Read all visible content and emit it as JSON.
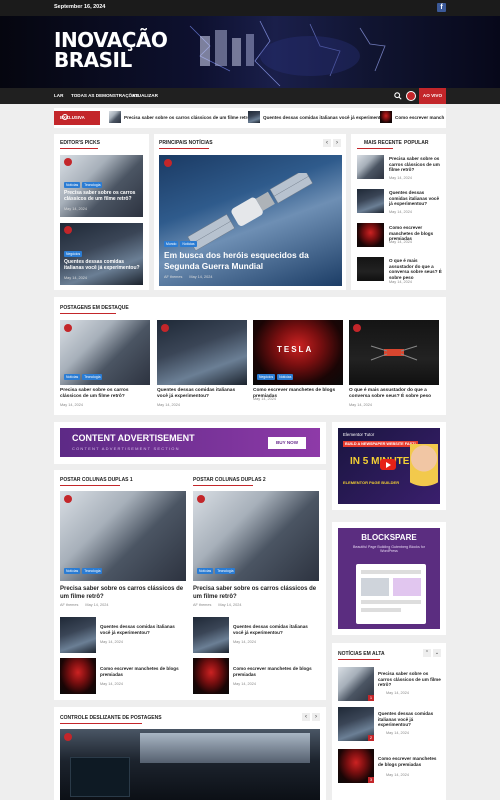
{
  "topbar": {
    "date": "September 16, 2024"
  },
  "logo": {
    "line1": "INOVAÇÃO",
    "line2": "BRASIL"
  },
  "nav": {
    "items": [
      "LAR",
      "TODAS AS DEMONSTRAÇÕES",
      "ATUALIZAR"
    ],
    "live_label": "AO VIVO"
  },
  "ticker": {
    "label": "EXCLUSIVA",
    "items": [
      "Precisa saber sobre os carros clássicos de um filme retrô?",
      "Quentes dessas comidas italianas você já experimentou?",
      "Como escrever manch"
    ]
  },
  "editors_picks": {
    "title": "EDITOR'S PICKS",
    "items": [
      {
        "cats": [
          "Notícias",
          "Tecnologia"
        ],
        "title": "Precisa saber sobre os carros clássicos de um filme retrô?",
        "date": "May 14, 2024"
      },
      {
        "cats": [
          "Negócios"
        ],
        "title": "Quentes dessas comidas italianas você já experimentou?",
        "date": "May 14, 2024"
      }
    ]
  },
  "main_news": {
    "title": "PRINCIPAIS NOTÍCIAS",
    "cats": [
      "Mundo",
      "Notícias"
    ],
    "headline": "Em busca dos heróis esquecidos da Segunda Guerra Mundial",
    "author": "AF themes",
    "date": "May 14, 2024"
  },
  "side_tabs": {
    "tab1": "MAIS RECENTE",
    "tab2": "POPULAR",
    "items": [
      {
        "title": "Precisa saber sobre os carros clássicos de um filme retrô?",
        "date": "May 14, 2024"
      },
      {
        "title": "Quentes dessas comidas italianas você já experimentou?",
        "date": "May 14, 2024"
      },
      {
        "title": "Como escrever manchetes de blogs premiadas",
        "date": "May 14, 2024"
      },
      {
        "title": "O que é mais assustador do que a conversa sobre seus? É sobre peso",
        "date": "May 14, 2024"
      }
    ]
  },
  "featured": {
    "title": "POSTAGENS EM DESTAQUE",
    "items": [
      {
        "cats": [
          "Notícias",
          "Tecnologia"
        ],
        "title": "Precisa saber sobre os carros clássicos de um filme retrô?",
        "date": "May 14, 2024"
      },
      {
        "cats": [],
        "title": "Quentes dessas comidas italianas você já experimentou?",
        "date": "May 14, 2024"
      },
      {
        "cats": [
          "Negócios",
          "Notícias"
        ],
        "title": "Como escrever manchetes de blogs premiadas",
        "date": "May 14, 2024"
      },
      {
        "cats": [],
        "title": "O que é mais assustador do que a conversa sobre seus? É sobre peso",
        "date": "May 14, 2024"
      }
    ],
    "tesla_text": "TESLA"
  },
  "ad": {
    "title": "CONTENT ADVERTISEMENT",
    "sub": "CONTENT ADVERTISEMENT SECTION",
    "button": "BUY NOW"
  },
  "video_ad": {
    "line1": "Elementor Tutor",
    "line2": "BUILD A NEWSPAPER WEBSITE FAST!",
    "line3": "IN 5 MINUTES",
    "line4": "ELEMENTOR PAGE BUILDER"
  },
  "blockspare": {
    "title": "BLOCKSPARE",
    "sub": "Beautiful Page Building Gutenberg Blocks for WordPress"
  },
  "double1": {
    "title": "POSTAR COLUNAS DUPLAS 1",
    "main": {
      "cats": [
        "Notícias",
        "Tecnologia"
      ],
      "title": "Precisa saber sobre os carros clássicos de um filme retrô?",
      "author": "AF themes",
      "date": "May 14, 2024"
    },
    "list": [
      {
        "title": "Quentes dessas comidas italianas você já experimentou?",
        "date": "May 14, 2024"
      },
      {
        "title": "Como escrever manchetes de blogs premiadas",
        "date": "May 14, 2024"
      }
    ]
  },
  "double2": {
    "title": "POSTAR COLUNAS DUPLAS 2",
    "main": {
      "cats": [
        "Notícias",
        "Tecnologia"
      ],
      "title": "Precisa saber sobre os carros clássicos de um filme retrô?",
      "author": "AF themes",
      "date": "May 14, 2024"
    },
    "list": [
      {
        "title": "Quentes dessas comidas italianas você já experimentou?",
        "date": "May 14, 2024"
      },
      {
        "title": "Como escrever manchetes de blogs premiadas",
        "date": "May 14, 2024"
      }
    ]
  },
  "trending": {
    "title": "NOTÍCIAS EM ALTA",
    "items": [
      {
        "title": "Precisa saber sobre os carros clássicos de um filme retrô?",
        "date": "May 14, 2024",
        "num": "1"
      },
      {
        "title": "Quentes dessas comidas italianas você já experimentou?",
        "date": "May 14, 2024",
        "num": "2"
      },
      {
        "title": "Como escrever manchetes de blogs premiadas",
        "date": "May 14, 2024",
        "num": "3"
      }
    ]
  },
  "slider": {
    "title": "CONTROLE DESLIZANTE DE POSTAGENS"
  },
  "colors": {
    "accent": "#c3262a",
    "category_blue": "#2b7cd3",
    "nav_bg": "#202020"
  }
}
